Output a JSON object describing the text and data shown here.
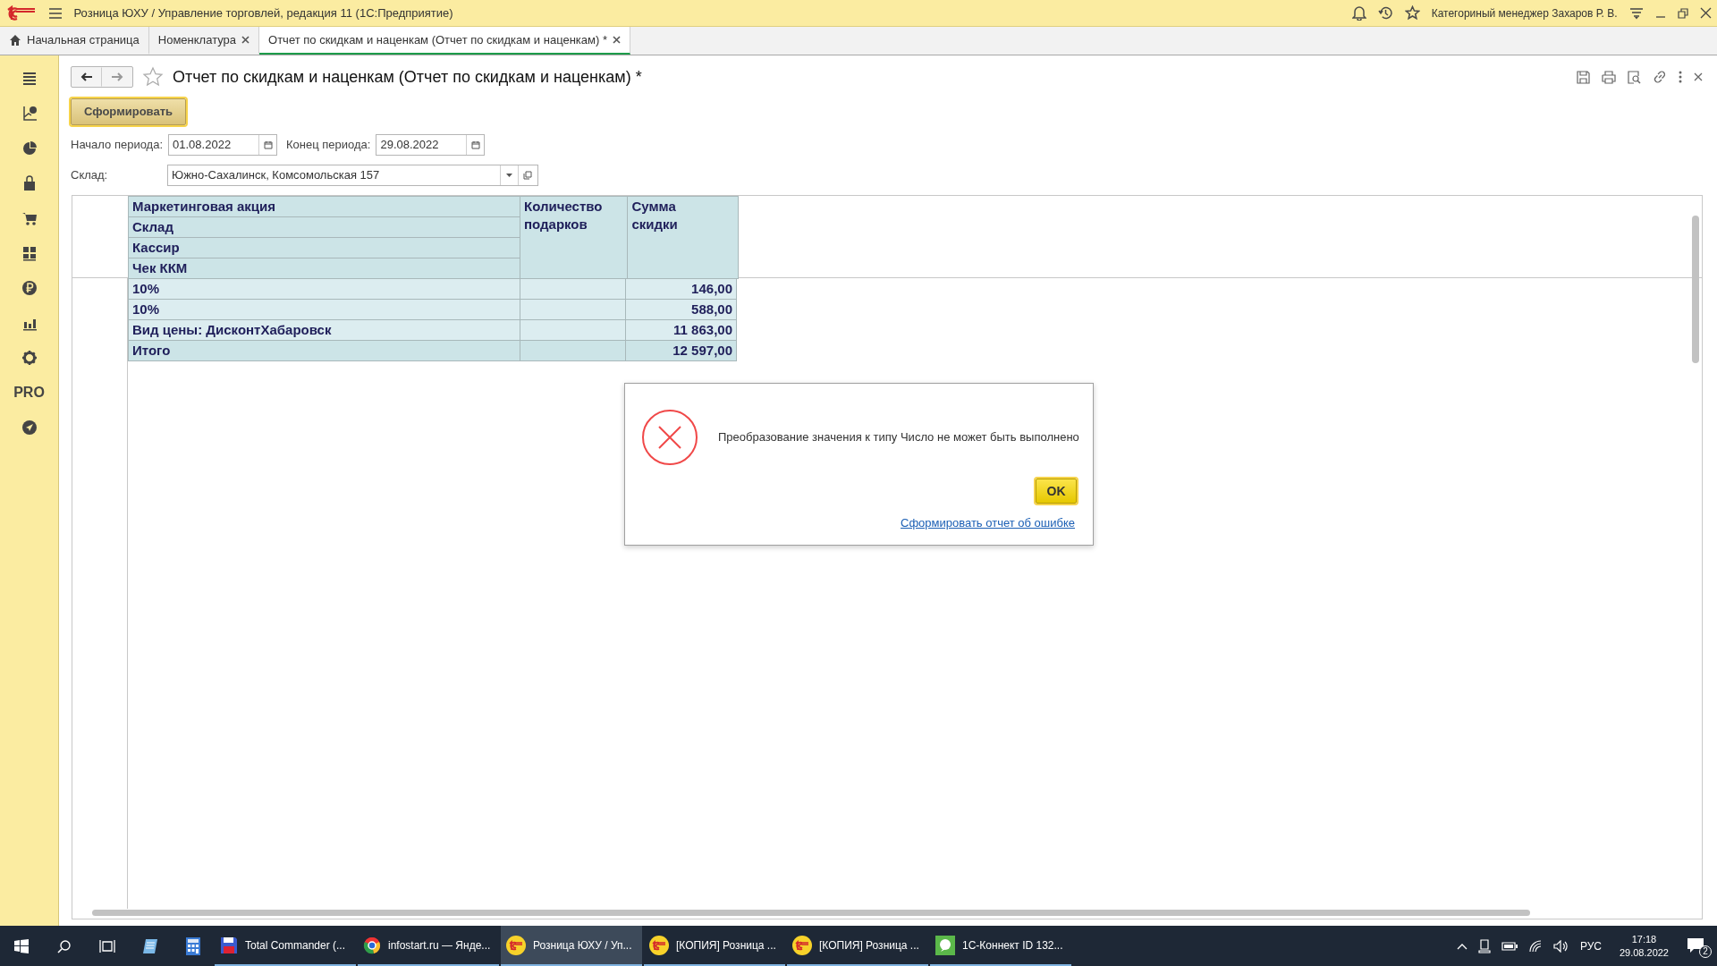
{
  "window": {
    "title": "Розница ЮХУ / Управление торговлей, редакция 11  (1С:Предприятие)",
    "user": "Категориный менеджер Захаров Р. В."
  },
  "tabs": [
    {
      "label": "Начальная страница",
      "selected": false,
      "closable": false
    },
    {
      "label": "Номенклатура",
      "selected": false,
      "closable": true
    },
    {
      "label": "Отчет по скидкам и наценкам (Отчет по скидкам и наценкам) *",
      "selected": true,
      "closable": true
    }
  ],
  "sidebar": {
    "text_item": "PRO"
  },
  "form": {
    "title": "Отчет по скидкам и наценкам (Отчет по скидкам и наценкам) *",
    "generate_button": "Сформировать",
    "period_start": {
      "label": "Начало периода:",
      "value": "01.08.2022"
    },
    "period_end": {
      "label": "Конец периода:",
      "value": "29.08.2022"
    },
    "warehouse": {
      "label": "Склад:",
      "value": "Южно-Сахалинск, Комсомольская 157"
    }
  },
  "report": {
    "row_headers": [
      "Маркетинговая акция",
      "Склад",
      "Кассир",
      "Чек ККМ"
    ],
    "columns": [
      "Количество подарков",
      "Сумма скидки"
    ],
    "rows": [
      {
        "kind": "data",
        "label": "10%",
        "sum": "146,00"
      },
      {
        "kind": "data",
        "label": "10%",
        "sum": "588,00"
      },
      {
        "kind": "data",
        "label": "Вид цены: ДисконтХабаровск",
        "sum": "11 863,00"
      },
      {
        "kind": "total",
        "label": "Итого",
        "sum": "12 597,00"
      }
    ]
  },
  "dialog": {
    "message": "Преобразование значения к типу Число не может быть выполнено",
    "button": "OK",
    "link": "Сформировать отчет об ошибке"
  },
  "taskbar": {
    "apps": [
      {
        "label": "Total Commander (...",
        "selected": false
      },
      {
        "label": "infostart.ru — Янде...",
        "selected": false
      },
      {
        "label": "Розница ЮХУ / Уп...",
        "selected": true
      },
      {
        "label": "[КОПИЯ] Розница ...",
        "selected": false
      },
      {
        "label": "[КОПИЯ] Розница ...",
        "selected": false
      },
      {
        "label": "1С-Коннект ID 132...",
        "selected": false
      }
    ],
    "language": "РУС",
    "time": "17:18",
    "date": "29.08.2022",
    "notifications": "2"
  }
}
